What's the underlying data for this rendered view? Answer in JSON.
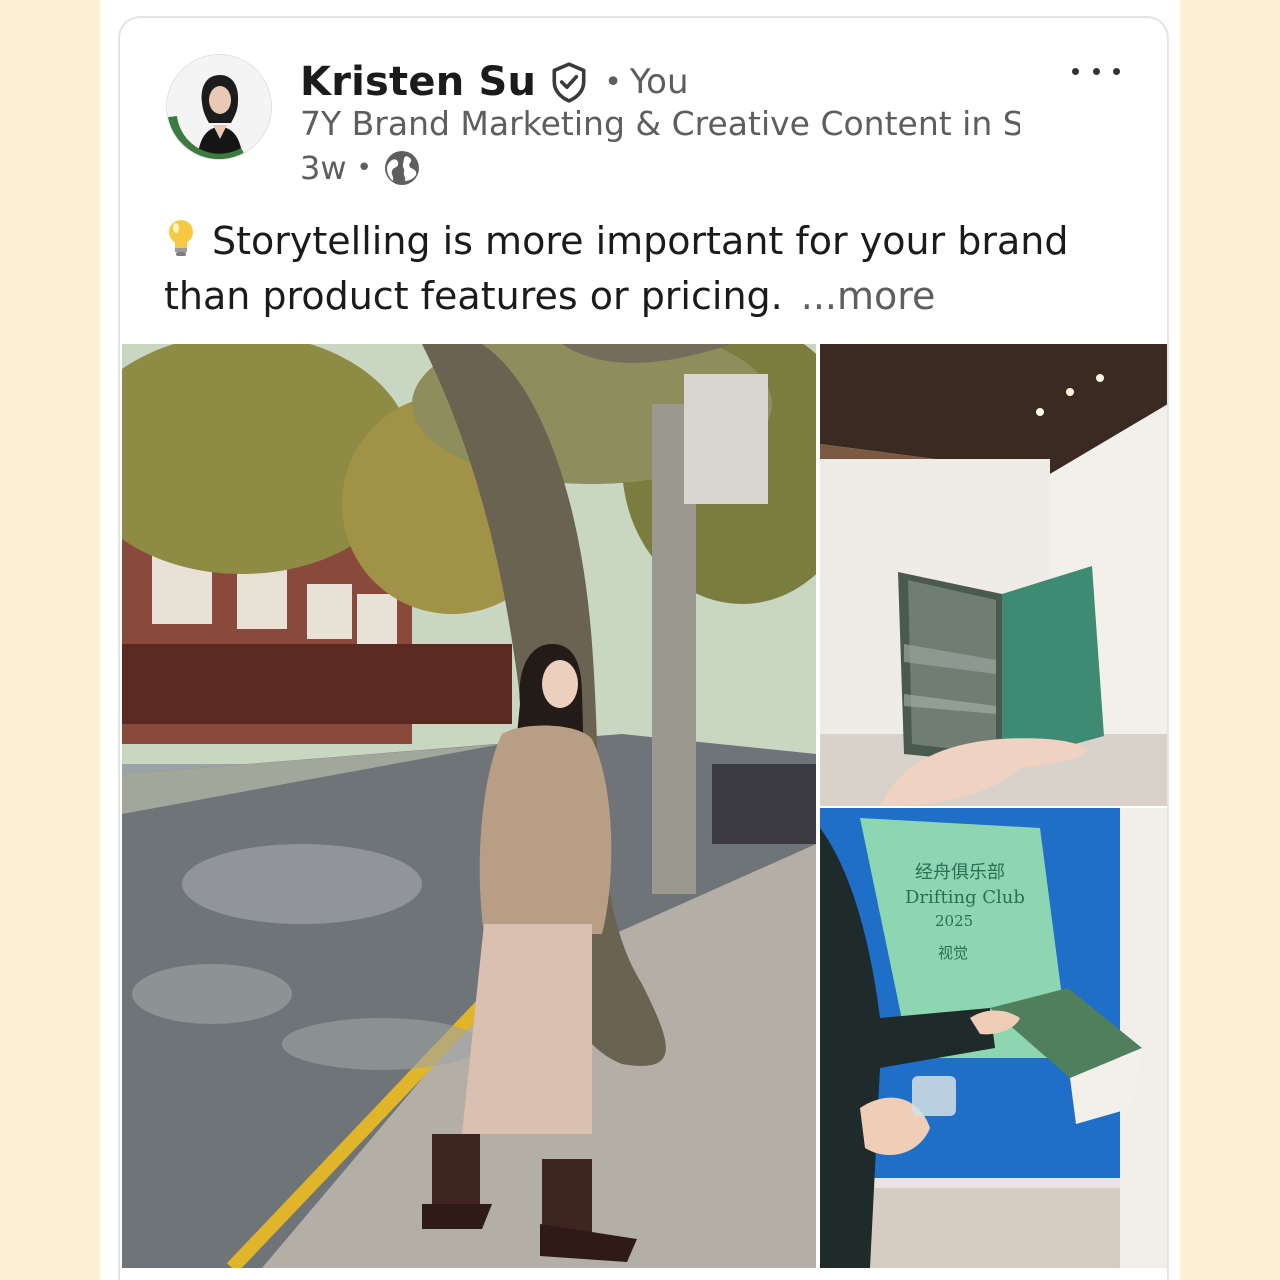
{
  "post": {
    "author_name": "Kristen Su",
    "connection_label": "You",
    "headline": "7Y Brand Marketing & Creative Content in S...",
    "timestamp": "3w",
    "visibility_icon": "globe-icon",
    "text_line1": "Storytelling is more important for your brand",
    "text_line2": "than product features or pricing.",
    "more_label": "...more",
    "avatar_badge": "#OPENTOWORK"
  },
  "images": {
    "book_cover_lines": [
      "经舟俱乐部",
      "Drifting Club",
      "2025",
      "视觉"
    ]
  },
  "colors": {
    "background": "#fbf0d4",
    "text_primary": "#1b1b1b",
    "text_secondary": "#5e5e5e",
    "open_to_work_green": "#3c7a3e"
  }
}
